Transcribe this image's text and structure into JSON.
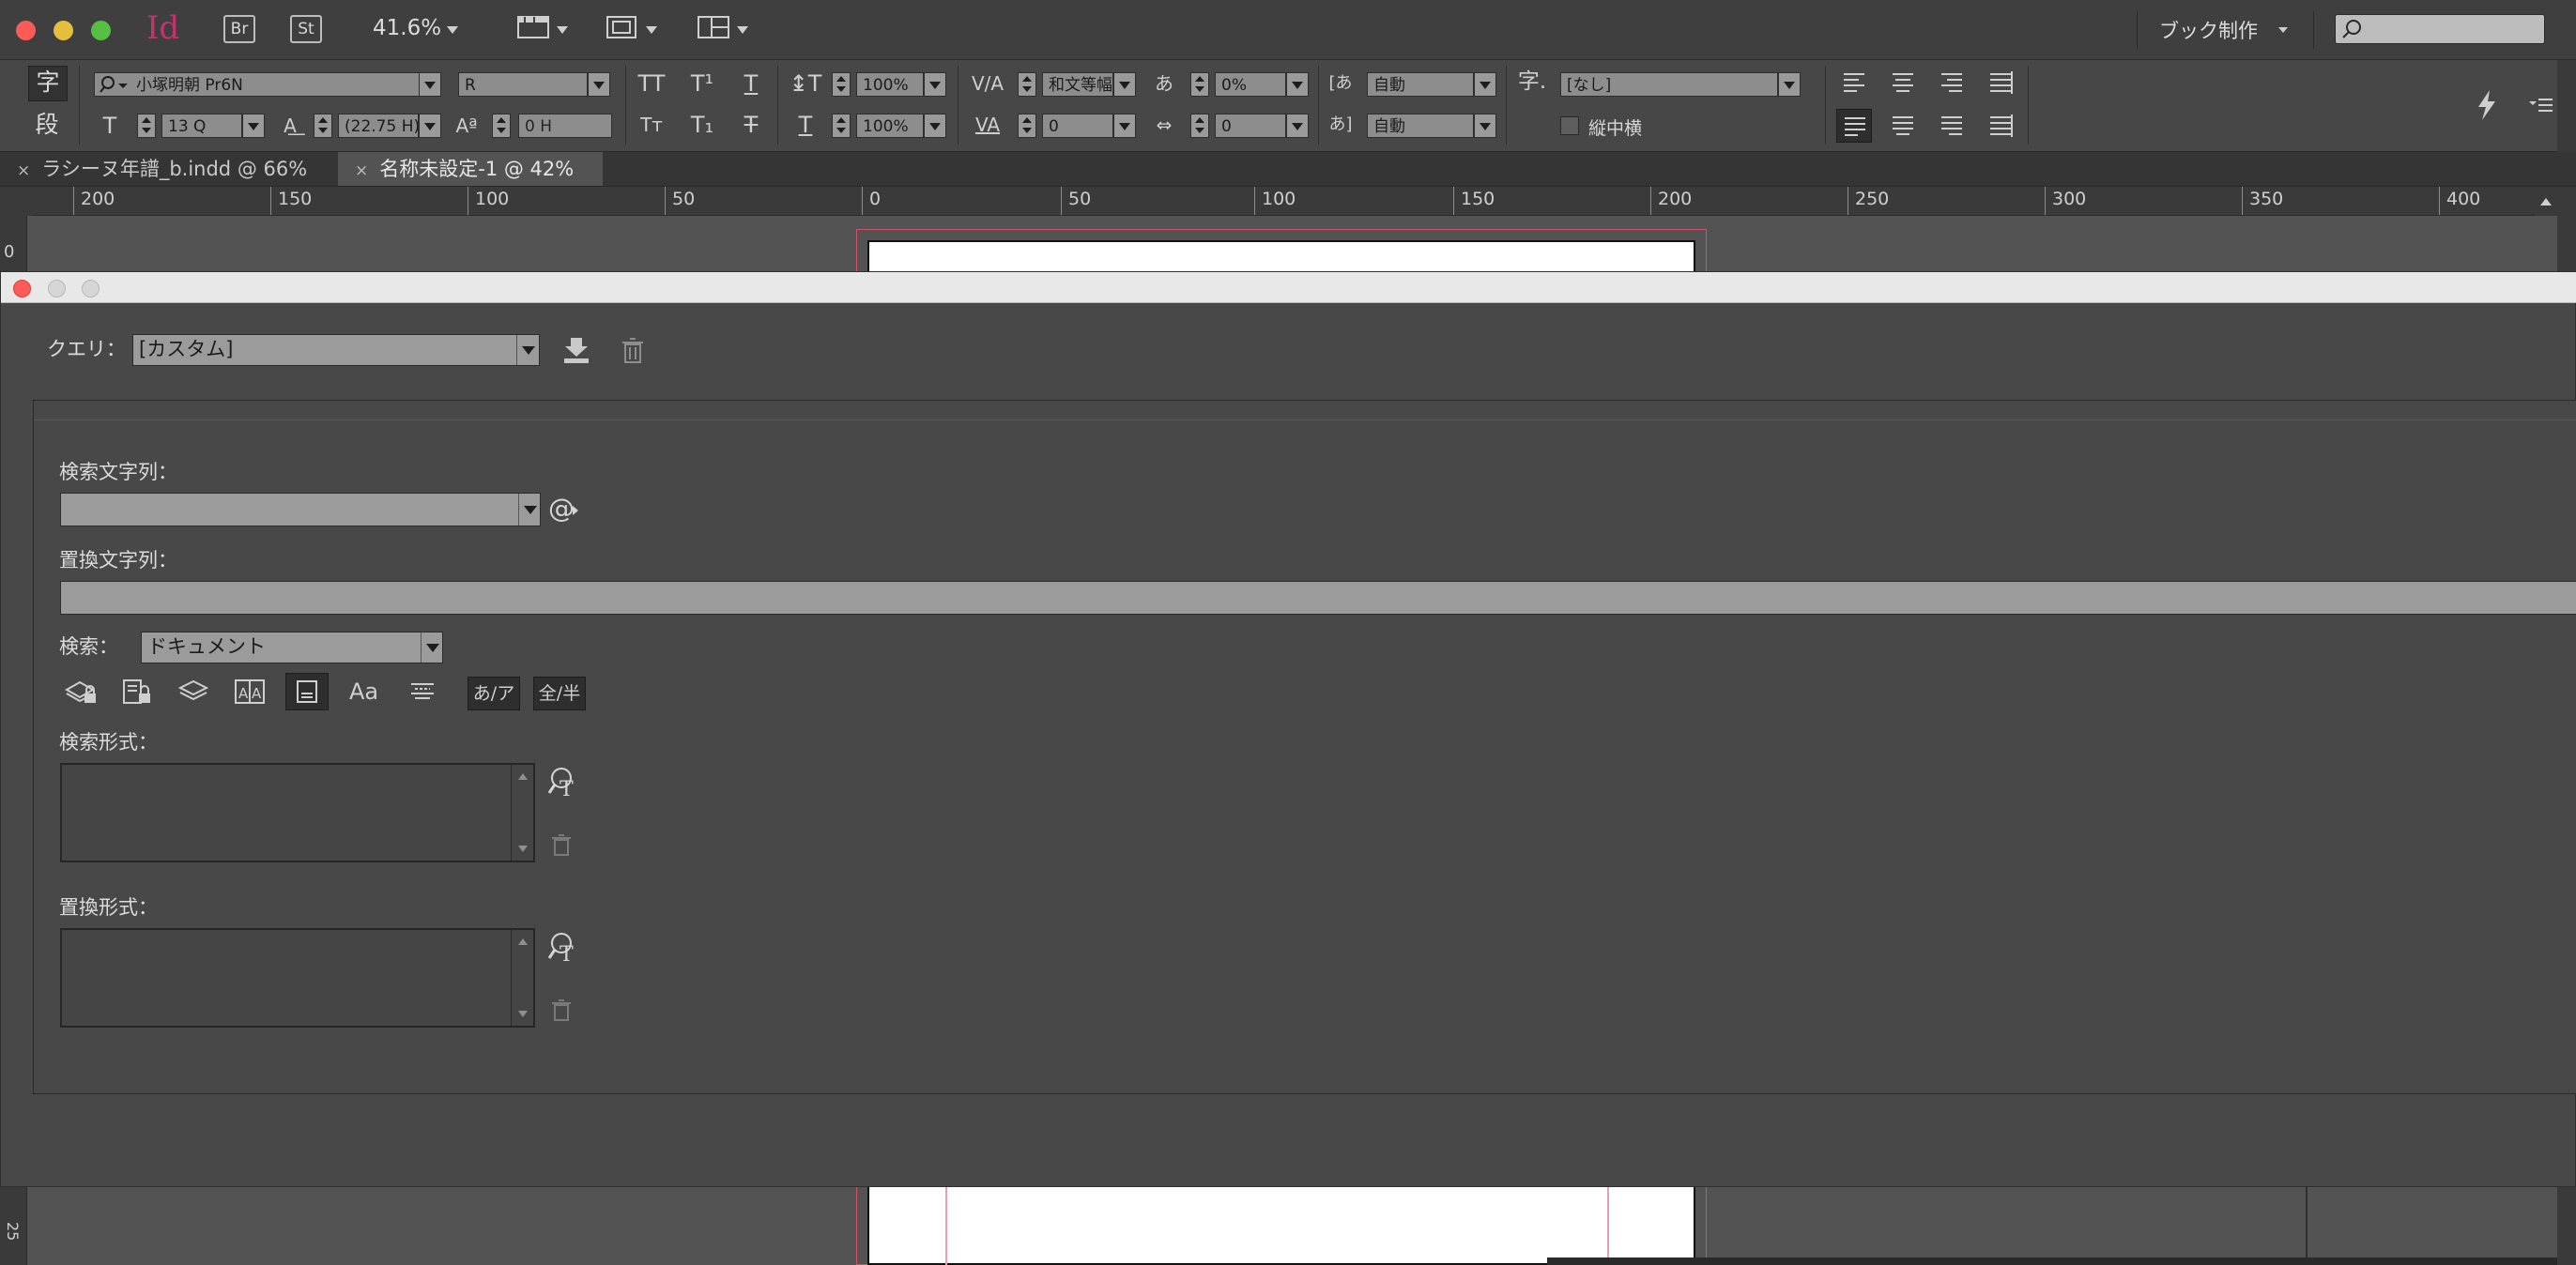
{
  "app": {
    "logo": "Id",
    "bridge": "Br",
    "stock": "St",
    "zoom": "41.6%",
    "workspace": "ブック制作",
    "colors": {
      "logo": "#c5336e",
      "close": "#fc5b57",
      "minimize": "#e5bf3c",
      "maximize": "#56c042"
    }
  },
  "control": {
    "char_mode": "字",
    "para_mode": "段",
    "font_family": "小塚明朝 Pr6N",
    "font_style": "R",
    "font_size": "13 Q",
    "leading": "(22.75 H)",
    "vertical_scale": "100%",
    "horizontal_scale": "100%",
    "mojikumi": "和文等幅",
    "tracking_pct": "0%",
    "kerning": "0",
    "baseline": "0 H",
    "tsume": "0",
    "aki_before": "自動",
    "aki_after": "自動",
    "char_style_glyph": "字.",
    "char_style": "[なし]",
    "tate_chu_yoko": "縦中横"
  },
  "tabs": [
    {
      "label": "ラシーヌ年譜_b.indd @ 66%",
      "close": "×"
    },
    {
      "label": "名称未設定-1 @ 42%",
      "close": "×"
    }
  ],
  "ruler": {
    "labels": [
      "200",
      "150",
      "100",
      "50",
      "0",
      "50",
      "100",
      "150",
      "200",
      "250",
      "300",
      "350",
      "400"
    ],
    "v_top": "0",
    "v_bottom": "25"
  },
  "dialog": {
    "query_label": "クエリ：",
    "query_value": "[カスタム]",
    "find_what_label": "検索文字列：",
    "find_what_value": "",
    "special_char_glyph": "@",
    "change_to_label": "置換文字列：",
    "change_to_value": "",
    "search_label": "検索：",
    "search_value": "ドキュメント",
    "option_glyphs": {
      "kana": "あ/ア",
      "width": "全/半",
      "case": "Aa"
    },
    "find_format_label": "検索形式：",
    "change_format_label": "置換形式："
  }
}
